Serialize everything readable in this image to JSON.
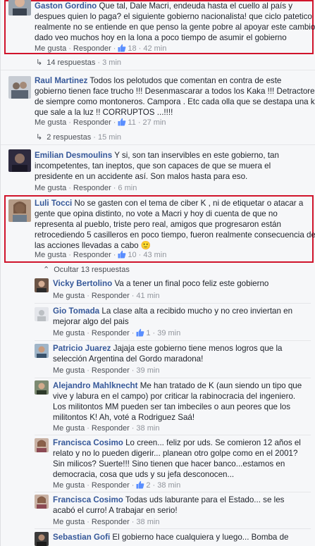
{
  "action_labels": {
    "like": "Me gusta",
    "reply": "Responder",
    "sep": "·"
  },
  "colors": {
    "link": "#365899",
    "meta": "#90949c",
    "highlight": "#d0142b",
    "background": "#f6f7f9"
  },
  "comments": [
    {
      "author": "Gaston Gordino",
      "lines": [
        "Que tal, Dale Macri, endeuda hasta el cuello al país y",
        "despues quien lo paga? el siguiente gobierno nacionalista! que ciclo patetico !",
        "realmente no se entiende en que penso la gente pobre al apoyar este cambio,",
        "dado veo muchos hoy en la lona a poco tiempo de asumir el gobierno"
      ],
      "likes": "18",
      "time": "42 min",
      "replies_label": "14 respuestas",
      "replies_time": "3 min"
    },
    {
      "author": "Raul Martinez",
      "lines": [
        "Todos los pelotudos que comentan en contra de este",
        "gobierno tienen face trucho !!! Desenmascarar a todos los Kaka !!! Detractores",
        "de siempre como montoneros. Campora . Etc cada olla que se destapa una kk",
        "que sale a la luz !! CORRUPTOS ...!!!!"
      ],
      "likes": "11",
      "time": "27 min",
      "replies_label": "2 respuestas",
      "replies_time": "15 min"
    },
    {
      "author": "Emilian Desmoulins",
      "lines": [
        "Y si, son tan inservibles en este gobierno, tan",
        "incompetentes, tan ineptos, que son capaces de que se muera el",
        "presidente en un accidente así. Son malos hasta para eso."
      ],
      "likes": "",
      "time": "6 min"
    },
    {
      "author": "Luli Tocci",
      "lines": [
        "No se gasten con el tema de ciber K , ni de etiquetar o atacar a",
        "gente que opina distinto, no vote a Macri y hoy di cuenta de que no",
        "representa al pueblo, triste pero real, amigos que progresaron están",
        "retrocediendo 5 casilleros en poco tiempo, fueron realmente consecuencia de",
        "las acciones llevadas a cabo"
      ],
      "emoji": "🙂",
      "likes": "10",
      "time": "43 min",
      "hide_label": "Ocultar 13 respuestas"
    }
  ],
  "replies": [
    {
      "author": "Vicky Bertolino",
      "lines": [
        "Va a tener un final poco feliz este gobierno"
      ],
      "likes": "",
      "time": "41 min"
    },
    {
      "author": "Gio Tomada",
      "lines": [
        "La clase alta a recibido mucho y no creo inviertan en",
        "mejorar algo del pais"
      ],
      "likes": "1",
      "time": "39 min"
    },
    {
      "author": "Patricio Juarez",
      "lines": [
        "Jajaja este gobierno tiene menos logros que la",
        "selección Argentina del Gordo maradona!"
      ],
      "likes": "",
      "time": "39 min"
    },
    {
      "author": "Alejandro Mahlknecht",
      "lines": [
        "Me han tratado de K (aun siendo un tipo que",
        "vive y labura en el campo) por criticar la rabinocracia del ingeniero.",
        "Los militontos MM pueden ser tan imbeciles o aun peores que los",
        "militontos K! Ah, voté a Rodriguez Saá!"
      ],
      "likes": "",
      "time": "38 min"
    },
    {
      "author": "Francisca Cosimo",
      "lines": [
        "Lo creen... feliz por uds. Se comieron 12 años el",
        "relato y no lo pueden digerir... planean otro golpe como en el 2001?",
        "Sin milicos? Suerte!!! Sino tienen que hacer banco...estamos en",
        "democracia, cosa que uds y su jefa desconocen..."
      ],
      "likes": "2",
      "time": "38 min"
    },
    {
      "author": "Francisca Cosimo",
      "lines": [
        "Todas uds laburante para el Estado... se les",
        "acabó el curro! A trabajar en serio!"
      ],
      "likes": "",
      "time": "38 min"
    },
    {
      "author": "Sebastian Gofi",
      "lines": [
        "El gobierno hace cualquiera y luego... Bomba de"
      ],
      "likes": "",
      "time": ""
    }
  ]
}
